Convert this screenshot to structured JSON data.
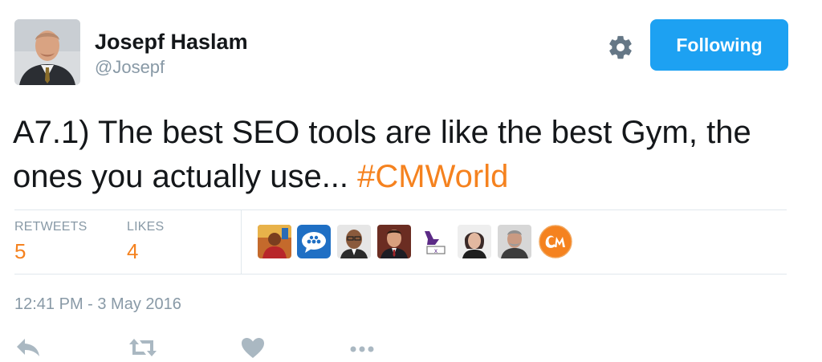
{
  "author": {
    "name": "Josepf Haslam",
    "handle": "@Josepf",
    "follow_label": "Following",
    "settings_icon": "gear-icon"
  },
  "tweet": {
    "text_prefix": "A7.1) The best SEO tools are like the best Gym, the ones you actually use... ",
    "hashtag": "#CMWorld"
  },
  "stats": {
    "retweets_label": "RETWEETS",
    "retweets_count": "5",
    "likes_label": "LIKES",
    "likes_count": "4"
  },
  "likers": [
    "liker-avatar-1",
    "liker-avatar-2",
    "liker-avatar-3",
    "liker-avatar-4",
    "liker-avatar-5",
    "liker-avatar-6",
    "liker-avatar-7",
    "liker-avatar-8"
  ],
  "timestamp": "12:41 PM - 3 May 2016",
  "actions": [
    "reply-icon",
    "retweet-icon",
    "like-icon",
    "more-icon"
  ],
  "colors": {
    "accent_orange": "#f5821f",
    "follow_blue": "#1da1f2",
    "muted_gray": "#8899a6",
    "icon_gray": "#aab8c2"
  }
}
